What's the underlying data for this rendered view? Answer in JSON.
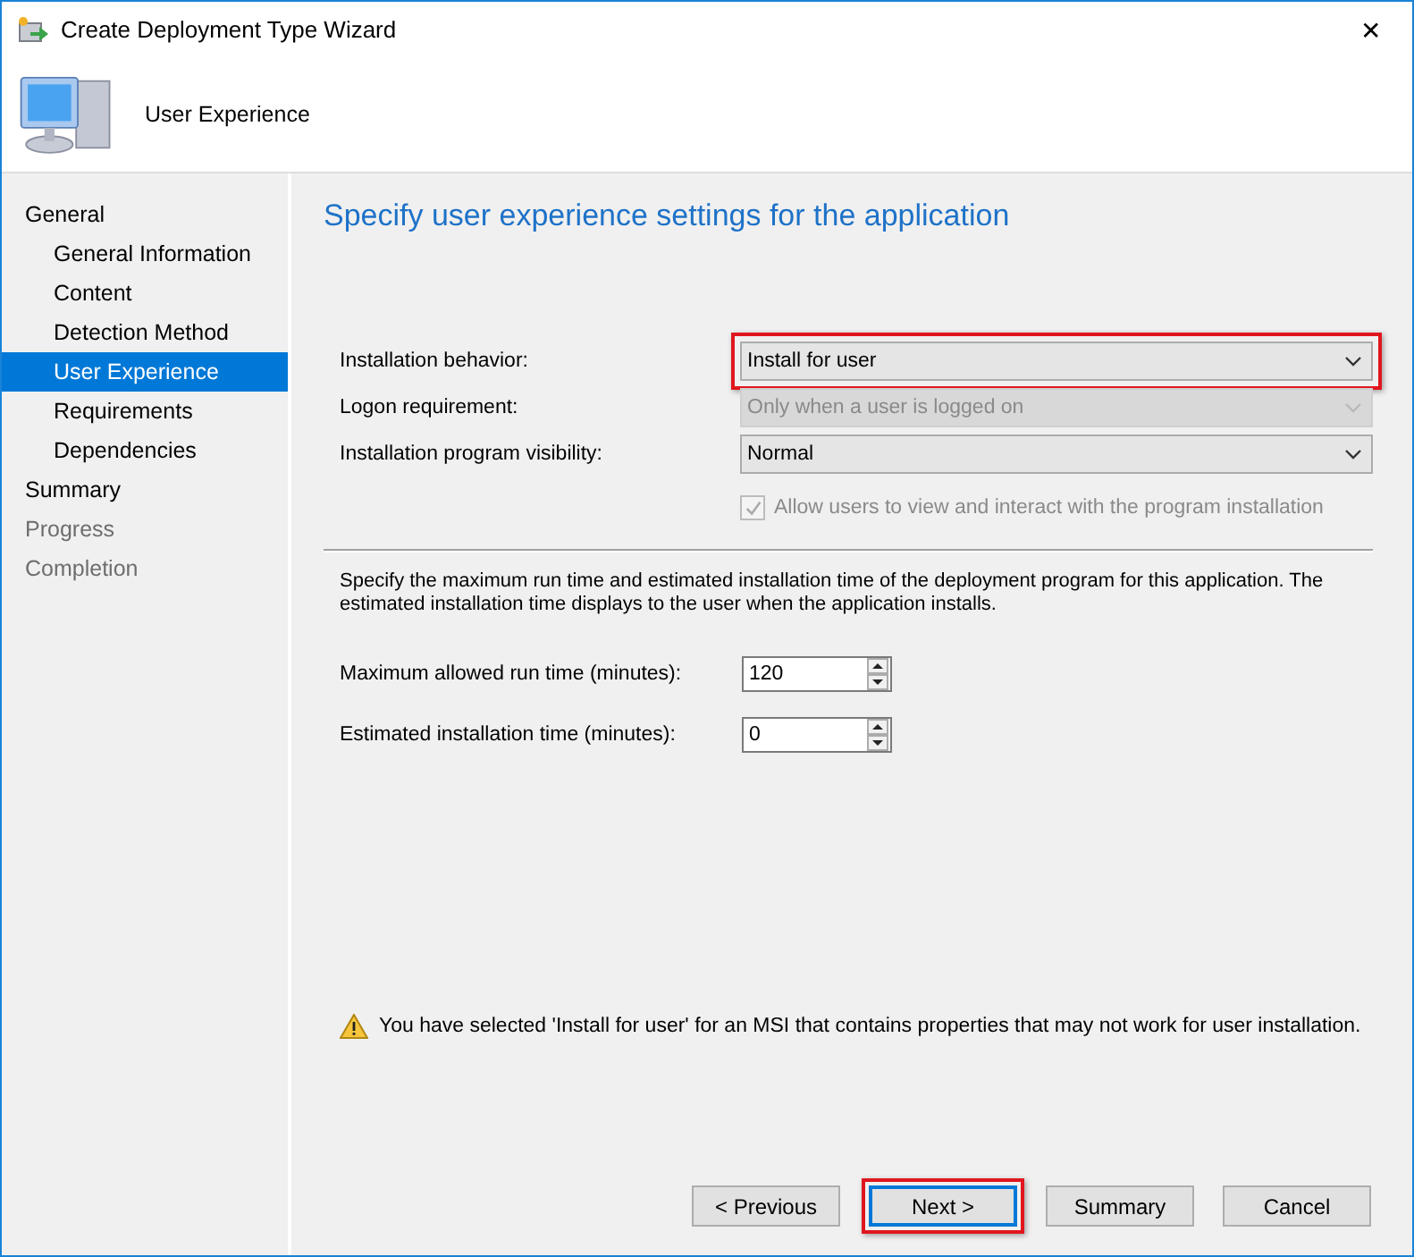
{
  "window": {
    "title": "Create Deployment Type Wizard",
    "close": "✕"
  },
  "header": {
    "title": "User Experience"
  },
  "sidebar": {
    "items": [
      {
        "label": "General",
        "selected": false,
        "disabled": false,
        "children": [
          {
            "label": "General Information",
            "selected": false,
            "disabled": false
          },
          {
            "label": "Content",
            "selected": false,
            "disabled": false
          },
          {
            "label": "Detection Method",
            "selected": false,
            "disabled": false
          },
          {
            "label": "User Experience",
            "selected": true,
            "disabled": false
          },
          {
            "label": "Requirements",
            "selected": false,
            "disabled": false
          },
          {
            "label": "Dependencies",
            "selected": false,
            "disabled": false
          }
        ]
      },
      {
        "label": "Summary",
        "selected": false,
        "disabled": false
      },
      {
        "label": "Progress",
        "selected": false,
        "disabled": true
      },
      {
        "label": "Completion",
        "selected": false,
        "disabled": true
      }
    ]
  },
  "page": {
    "heading": "Specify user experience settings for the application",
    "settings": [
      {
        "label": "Installation behavior:",
        "value": "Install for user",
        "disabled": false,
        "highlighted": true
      },
      {
        "label": "Logon requirement:",
        "value": "Only when a user is logged on",
        "disabled": true,
        "highlighted": false
      },
      {
        "label": "Installation program visibility:",
        "value": "Normal",
        "disabled": false,
        "highlighted": false
      }
    ],
    "allow_interact": {
      "label": "Allow users to view and interact with the program installation",
      "checked": true,
      "disabled": true
    },
    "description": "Specify the maximum run time and estimated installation time of the deployment program for this application. The estimated installation time displays to the user when the application installs.",
    "times": [
      {
        "label": "Maximum allowed run time (minutes):",
        "value": "120"
      },
      {
        "label": "Estimated installation time (minutes):",
        "value": "0"
      }
    ],
    "warning": "You have selected 'Install for user' for an MSI that contains properties that may not work for user installation."
  },
  "buttons": [
    {
      "label": "< Previous",
      "default": false,
      "highlighted": false
    },
    {
      "label": "Next >",
      "default": true,
      "highlighted": true
    },
    {
      "label": "Summary",
      "default": false,
      "highlighted": false
    },
    {
      "label": "Cancel",
      "default": false,
      "highlighted": false
    }
  ]
}
